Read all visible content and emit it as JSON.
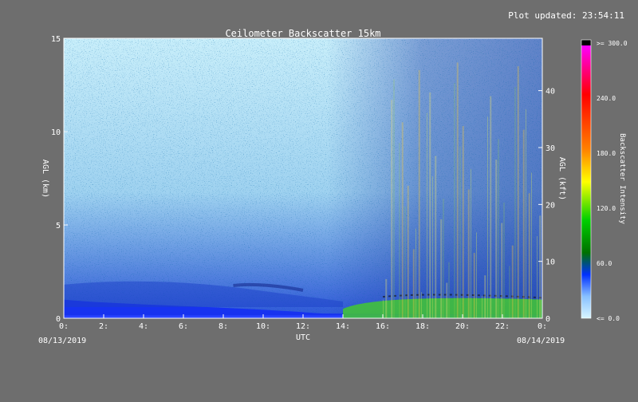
{
  "header": {
    "updated_label": "Plot updated: 23:54:11"
  },
  "chart_data": {
    "type": "heatmap",
    "title": "Ceilometer Backscatter 15km",
    "xlabel": "UTC",
    "ylabel_left": "AGL (km)",
    "ylabel_right": "AGL (kft)",
    "xlim": [
      0,
      24
    ],
    "ylim_km": [
      0,
      15
    ],
    "ylim_kft": [
      0,
      49.2
    ],
    "x_ticks": [
      "0:",
      "2:",
      "4:",
      "6:",
      "8:",
      "10:",
      "12:",
      "14:",
      "16:",
      "18:",
      "20:",
      "22:",
      "0:"
    ],
    "y_ticks_left": [
      "0",
      "5",
      "10",
      "15"
    ],
    "y_ticks_right": [
      "0",
      "10",
      "20",
      "30",
      "40"
    ],
    "date_start": "08/13/2019",
    "date_end": "08/14/2019",
    "colorbar": {
      "label": "Backscatter Intensity",
      "min": 0,
      "max": 300,
      "tick_labels": [
        ">= 300.0",
        "240.0",
        "180.0",
        "120.0",
        "60.0",
        "<= 0.0"
      ],
      "colors": [
        "#000000",
        "#ff00ff",
        "#ff0000",
        "#ff7000",
        "#ffd400",
        "#ffff00",
        "#a0e000",
        "#00d000",
        "#007000",
        "#0040ff",
        "#0000d0",
        "#8ab8ff",
        "#d8f6ff"
      ]
    },
    "features": [
      {
        "name": "surface layer",
        "x_range": [
          0,
          24
        ],
        "height_km": [
          0,
          0.6
        ],
        "intensity": 50
      },
      {
        "name": "residual aerosol layer",
        "x_range": [
          0,
          14
        ],
        "height_km": [
          0.5,
          2.5
        ],
        "intensity": 35
      },
      {
        "name": "boundary layer",
        "x_range": [
          14,
          24
        ],
        "height_km": [
          0,
          1.2
        ],
        "intensity": 90
      },
      {
        "name": "noisy columns",
        "x_range": [
          16,
          24
        ],
        "height_km": [
          0,
          15
        ],
        "intensity": 110
      }
    ]
  }
}
